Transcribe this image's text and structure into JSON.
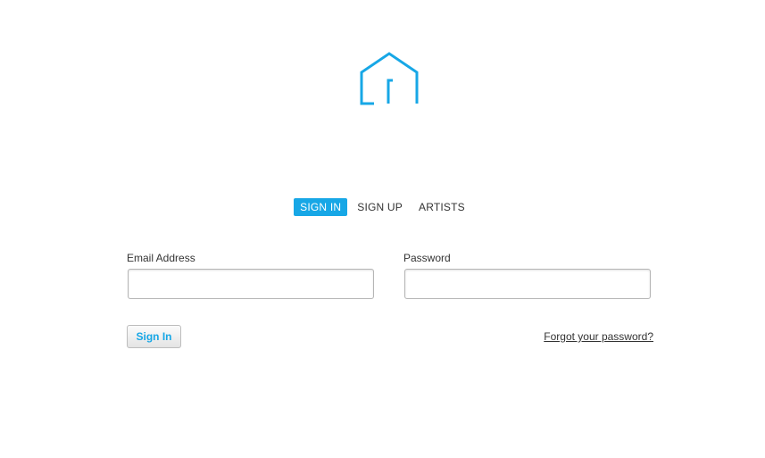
{
  "logo": {
    "icon": "house-icon",
    "color": "#17a7e6"
  },
  "tabs": [
    {
      "label": "SIGN IN",
      "active": true
    },
    {
      "label": "SIGN UP",
      "active": false
    },
    {
      "label": "ARTISTS",
      "active": false
    }
  ],
  "form": {
    "email_label": "Email Address",
    "email_value": "",
    "password_label": "Password",
    "password_value": "",
    "submit_label": "Sign In",
    "forgot_label": "Forgot your password?"
  },
  "colors": {
    "accent": "#17a7e6",
    "text": "#333333"
  }
}
